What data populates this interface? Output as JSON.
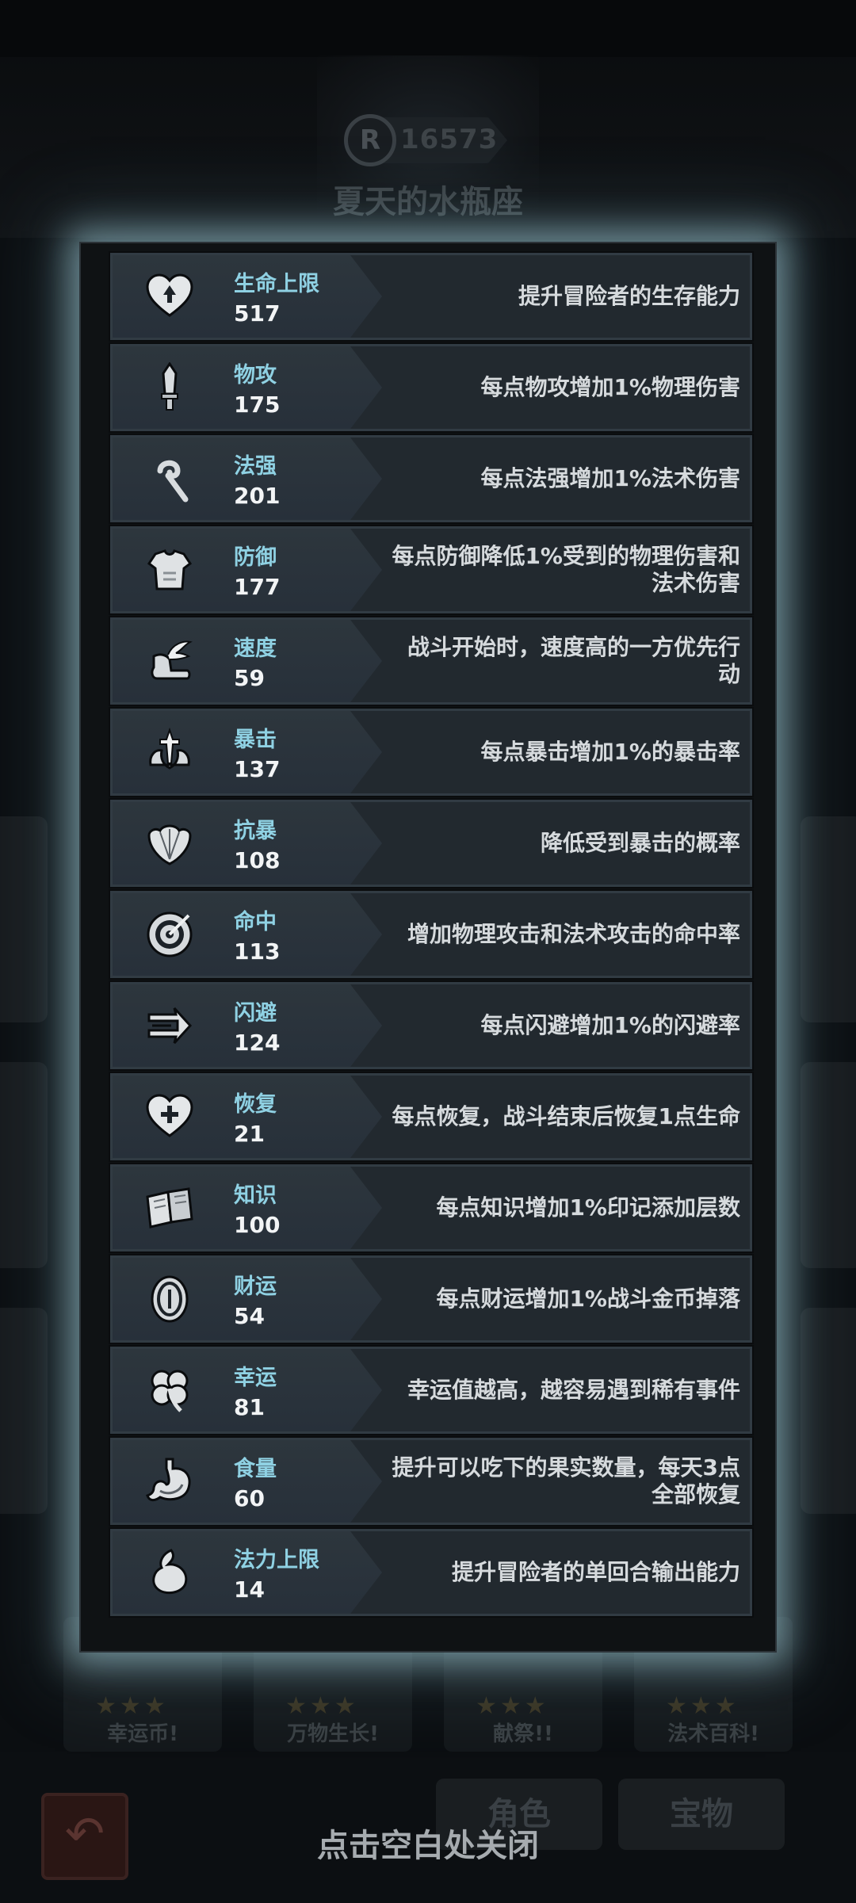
{
  "header": {
    "score": "16573",
    "player_name": "夏天的水瓶座"
  },
  "stats": [
    {
      "name": "生命上限",
      "value": "517",
      "desc": "提升冒险者的生存能力",
      "icon": "heart-up-icon"
    },
    {
      "name": "物攻",
      "value": "175",
      "desc": "每点物攻增加1%物理伤害",
      "icon": "sword-icon"
    },
    {
      "name": "法强",
      "value": "201",
      "desc": "每点法强增加1%法术伤害",
      "icon": "staff-icon"
    },
    {
      "name": "防御",
      "value": "177",
      "desc": "每点防御降低1%受到的物理伤害和法术伤害",
      "icon": "armor-icon"
    },
    {
      "name": "速度",
      "value": "59",
      "desc": "战斗开始时，速度高的一方优先行动",
      "icon": "winged-boot-icon"
    },
    {
      "name": "暴击",
      "value": "137",
      "desc": "每点暴击增加1%的暴击率",
      "icon": "critical-icon"
    },
    {
      "name": "抗暴",
      "value": "108",
      "desc": "降低受到暴击的概率",
      "icon": "shell-shield-icon"
    },
    {
      "name": "命中",
      "value": "113",
      "desc": "增加物理攻击和法术攻击的命中率",
      "icon": "target-icon"
    },
    {
      "name": "闪避",
      "value": "124",
      "desc": "每点闪避增加1%的闪避率",
      "icon": "dodge-arrow-icon"
    },
    {
      "name": "恢复",
      "value": "21",
      "desc": "每点恢复，战斗结束后恢复1点生命",
      "icon": "heart-plus-icon"
    },
    {
      "name": "知识",
      "value": "100",
      "desc": "每点知识增加1%印记添加层数",
      "icon": "book-icon"
    },
    {
      "name": "财运",
      "value": "54",
      "desc": "每点财运增加1%战斗金币掉落",
      "icon": "coin-icon"
    },
    {
      "name": "幸运",
      "value": "81",
      "desc": "幸运值越高，越容易遇到稀有事件",
      "icon": "clover-icon"
    },
    {
      "name": "食量",
      "value": "60",
      "desc": "提升可以吃下的果实数量，每天3点全部恢复",
      "icon": "stomach-icon"
    },
    {
      "name": "法力上限",
      "value": "14",
      "desc": "提升冒险者的单回合输出能力",
      "icon": "flame-drop-icon"
    }
  ],
  "background_cards": [
    "幸运币!",
    "万物生长!",
    "献祭!!",
    "法术百科!"
  ],
  "tabs": {
    "role": "角色",
    "treasure": "宝物"
  },
  "close_hint": "点击空白处关闭"
}
